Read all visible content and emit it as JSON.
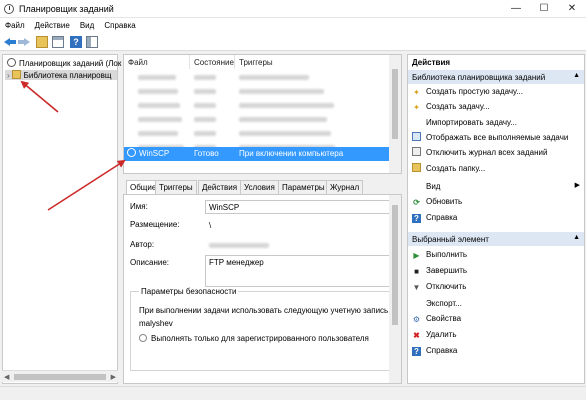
{
  "window": {
    "title": "Планировщик заданий",
    "minimize": "—",
    "maximize": "☐",
    "close": "✕"
  },
  "menu": [
    "Файл",
    "Действие",
    "Вид",
    "Справка"
  ],
  "tree": {
    "root": "Планировщик заданий (Лок",
    "library": "Библиотека планировщ",
    "expander": "›"
  },
  "task_list": {
    "columns": [
      "Файл",
      "Состояние",
      "Триггеры"
    ],
    "rows": [
      {
        "name": "WinSCP",
        "status": "Готово",
        "trigger": "При включении компьютера"
      }
    ]
  },
  "tabs": [
    "Общие",
    "Триггеры",
    "Действия",
    "Условия",
    "Параметры",
    "Журнал"
  ],
  "details": {
    "name_label": "Имя:",
    "name_value": "WinSCP",
    "location_label": "Размещение:",
    "location_value": "\\",
    "author_label": "Автор:",
    "description_label": "Описание:",
    "description_value": "FTP менеджер",
    "security_title": "Параметры безопасности",
    "security_text": "При выполнении задачи использовать следующую учетную запись по",
    "account": "malyshev",
    "run_only_logged": "Выполнять только для зарегистрированного пользователя"
  },
  "actions": {
    "header": "Действия",
    "library_section": "Библиотека планировщика заданий",
    "library_items": [
      {
        "label": "Создать простую задачу...",
        "icon": "create-basic-task-icon"
      },
      {
        "label": "Создать задачу...",
        "icon": "create-task-icon"
      },
      {
        "label": "Импортировать задачу...",
        "icon": "import-task-icon"
      },
      {
        "label": "Отображать все выполняемые задачи",
        "icon": "running-tasks-icon"
      },
      {
        "label": "Отключить журнал всех заданий",
        "icon": "disable-history-icon"
      },
      {
        "label": "Создать папку...",
        "icon": "new-folder-icon"
      },
      {
        "label": "Вид",
        "icon": "view-icon"
      },
      {
        "label": "Обновить",
        "icon": "refresh-icon"
      },
      {
        "label": "Справка",
        "icon": "help-icon"
      }
    ],
    "selected_section": "Выбранный элемент",
    "selected_items": [
      {
        "label": "Выполнить",
        "icon": "run-icon"
      },
      {
        "label": "Завершить",
        "icon": "end-icon"
      },
      {
        "label": "Отключить",
        "icon": "disable-icon"
      },
      {
        "label": "Экспорт...",
        "icon": "export-icon"
      },
      {
        "label": "Свойства",
        "icon": "properties-icon"
      },
      {
        "label": "Удалить",
        "icon": "delete-icon"
      },
      {
        "label": "Справка",
        "icon": "help-icon"
      }
    ]
  },
  "colors": {
    "selection": "#3399ff",
    "section_header": "#dde7f3",
    "annotation_arrow": "#cc2a2a"
  }
}
